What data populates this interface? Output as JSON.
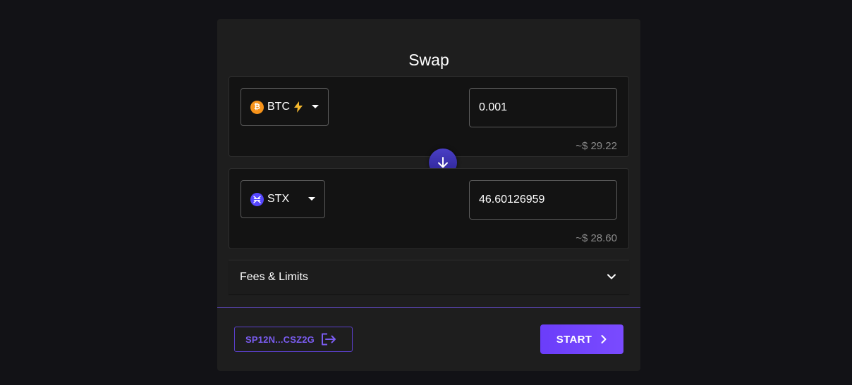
{
  "title": "Swap",
  "send": {
    "asset": "BTC",
    "icon": "bitcoin-icon",
    "lightning_icon": "lightning-bolt-icon",
    "amount": "0.001",
    "fiat_value": "~$ 29.22"
  },
  "receive": {
    "asset": "STX",
    "icon": "stacks-icon",
    "amount": "46.60126959",
    "fiat_value": "~$ 28.60"
  },
  "swap_direction_icon": "arrow-down-icon",
  "fees": {
    "label": "Fees & Limits",
    "icon": "chevron-down-icon"
  },
  "wallet": {
    "address": "SP12N...CSZ2G",
    "icon": "logout-icon"
  },
  "start": {
    "label": "START",
    "icon": "chevron-right-icon"
  },
  "colors": {
    "background": "#121216",
    "card": "#1e1e1e",
    "accent": "#6b3dfa",
    "bitcoin": "#f7931a",
    "stacks": "#5546ff",
    "lightning": "#f5b82e"
  }
}
